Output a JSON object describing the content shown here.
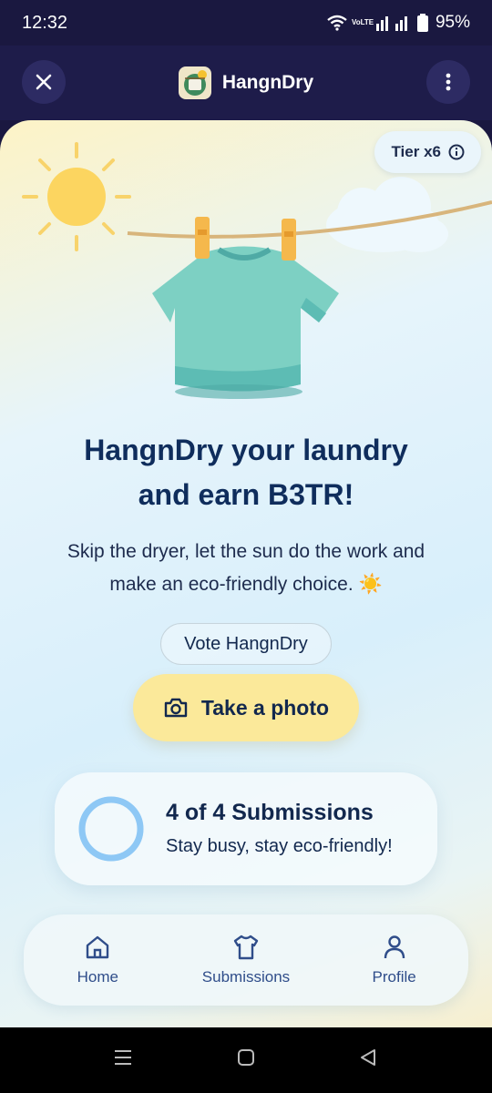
{
  "status": {
    "time": "12:32",
    "network": "VoLTE",
    "battery": "95%"
  },
  "header": {
    "title": "HangnDry"
  },
  "tier": {
    "label": "Tier x6"
  },
  "hero": {
    "headline_line1": "HangnDry your laundry",
    "headline_line2": "and earn B3TR!",
    "subtext_line1": "Skip the dryer, let the sun do the work and",
    "subtext_line2": "make an eco-friendly choice. ☀️"
  },
  "actions": {
    "vote_label": "Vote HangnDry",
    "photo_label": "Take a photo"
  },
  "submissions": {
    "title": "4 of 4 Submissions",
    "desc": "Stay busy, stay eco-friendly!",
    "used": 4,
    "total": 4
  },
  "nav": {
    "items": [
      {
        "label": "Home",
        "icon": "home-icon"
      },
      {
        "label": "Submissions",
        "icon": "shirt-icon"
      },
      {
        "label": "Profile",
        "icon": "person-icon"
      }
    ]
  },
  "colors": {
    "accent": "#fbe99a",
    "header": "#1e1c4a",
    "ring": "#8ec8f5",
    "text": "#12284e"
  }
}
